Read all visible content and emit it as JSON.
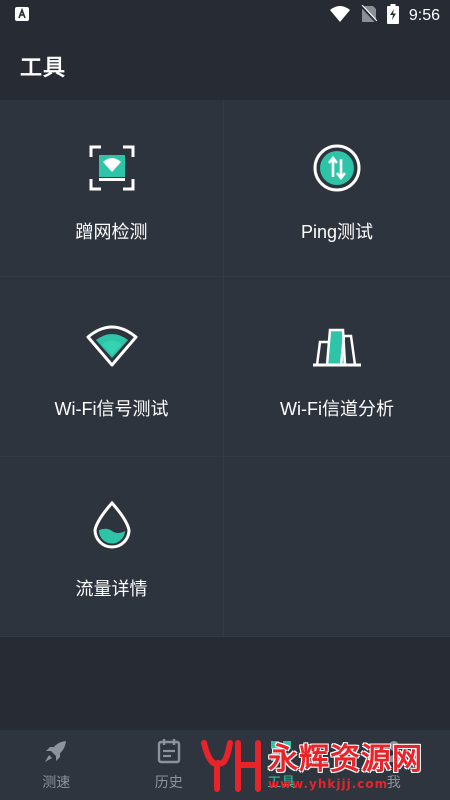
{
  "status_bar": {
    "time": "9:56",
    "notification_icon": "app-notification-icon",
    "wifi_icon": "wifi-signal-icon",
    "sim_icon": "no-sim-icon",
    "battery_icon": "battery-charging-icon"
  },
  "header": {
    "title": "工具"
  },
  "tools": [
    {
      "label": "蹭网检测",
      "icon": "wifi-scan-frame-icon"
    },
    {
      "label": "Ping测试",
      "icon": "ping-arrows-icon"
    },
    {
      "label": "Wi-Fi信号测试",
      "icon": "wifi-fan-icon"
    },
    {
      "label": "Wi-Fi信道分析",
      "icon": "channel-bars-icon"
    },
    {
      "label": "流量详情",
      "icon": "water-drop-icon"
    }
  ],
  "bottom_nav": [
    {
      "label": "测速",
      "icon": "rocket-icon"
    },
    {
      "label": "历史",
      "icon": "calendar-icon"
    },
    {
      "label": "工具",
      "icon": "tools-icon"
    },
    {
      "label": "我",
      "icon": "user-icon"
    }
  ],
  "watermark": {
    "main": "永辉资源网",
    "url": "www.yhkjjj.com",
    "logo": "YH"
  },
  "colors": {
    "background": "#262b34",
    "grid_background": "#2e343e",
    "accent": "#2ec4a8",
    "nav_text": "#8c939c",
    "watermark": "#e8232a"
  }
}
